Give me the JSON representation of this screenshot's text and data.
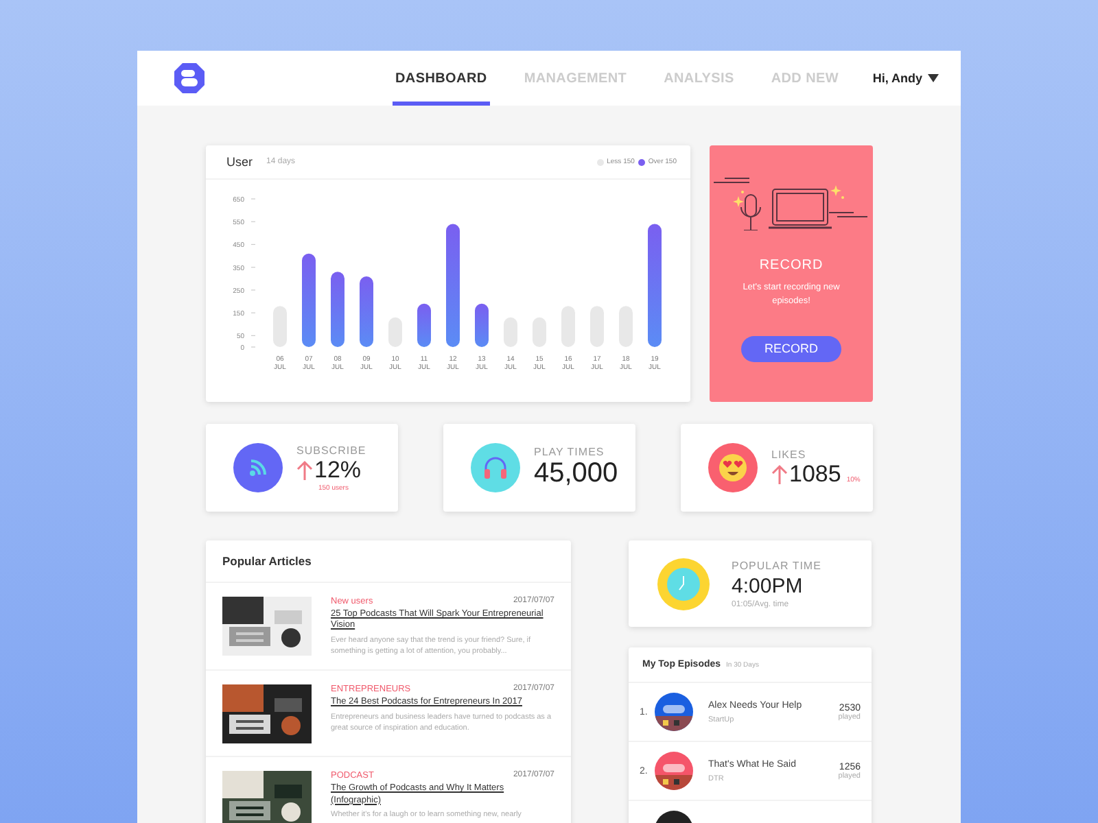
{
  "header": {
    "tabs": [
      {
        "label": "DASHBOARD",
        "selected": true
      },
      {
        "label": "MANAGEMENT",
        "selected": false
      },
      {
        "label": "ANALYSIS",
        "selected": false
      },
      {
        "label": "ADD NEW",
        "selected": false
      }
    ],
    "user": "Hi, Andy"
  },
  "user_chart": {
    "title": "User",
    "subtitle": "14 days",
    "chart_data": {
      "type": "bar",
      "categories": [
        "06 JUL",
        "07 JUL",
        "08 JUL",
        "09 JUL",
        "10 JUL",
        "11 JUL",
        "12 JUL",
        "13 JUL",
        "14 JUL",
        "15 JUL",
        "16 JUL",
        "17 JUL",
        "18 JUL",
        "19 JUL"
      ],
      "series": [
        {
          "name": "Less 150",
          "color": "#e8e8e8",
          "values": [
            180,
            null,
            null,
            null,
            130,
            null,
            null,
            null,
            130,
            130,
            180,
            180,
            180,
            null
          ]
        },
        {
          "name": "Over 150",
          "color": "#7a5ff0",
          "values": [
            null,
            410,
            330,
            310,
            null,
            190,
            540,
            190,
            null,
            null,
            null,
            null,
            null,
            540
          ]
        }
      ],
      "ylim": [
        0,
        650
      ],
      "yticks": [
        0,
        50,
        150,
        250,
        350,
        450,
        550,
        650
      ]
    }
  },
  "record": {
    "title": "RECORD",
    "text": "Let's start recording new episodes!",
    "button": "RECORD"
  },
  "stats": [
    {
      "kind": "subscribe",
      "label": "SUBSCRIBE",
      "value": "12%",
      "note": "150 users"
    },
    {
      "kind": "plays",
      "label": "PLAY TIMES",
      "value": "45,000"
    },
    {
      "kind": "likes",
      "label": "LIKES",
      "value": "1085",
      "note": "10%"
    }
  ],
  "articles": {
    "title": "Popular Articles",
    "items": [
      {
        "tag": "New users",
        "date": "2017/07/07",
        "title": "25 Top Podcasts That Will Spark Your Entrepreneurial Vision",
        "excerpt": "Ever heard anyone say that the trend is your friend? Sure, if something is getting a lot of attention, you probably..."
      },
      {
        "tag": "ENTREPRENEURS",
        "date": "2017/07/07",
        "title": "The 24 Best Podcasts for Entrepreneurs In 2017",
        "excerpt": "Entrepreneurs and business leaders have turned to podcasts as a great source of inspiration and education."
      },
      {
        "tag": "PODCAST",
        "date": "2017/07/07",
        "title": "The Growth of Podcasts and Why It Matters (Infographic)",
        "excerpt": "Whether it's for a laugh or to learn something new, nearly"
      }
    ]
  },
  "popular_time": {
    "label": "POPULAR TIME",
    "value": "4:00PM",
    "note": "01:05/Avg. time"
  },
  "episodes": {
    "title": "My Top Episodes",
    "subtitle": "In 30 Days",
    "items": [
      {
        "kind": "row",
        "rank": "1.",
        "title": "Alex Needs Your Help",
        "show": "StartUp",
        "count": "2530",
        "unit": "played",
        "color": "#1a5fe0"
      },
      {
        "kind": "row",
        "rank": "2.",
        "title": "That's What He Said",
        "show": "DTR",
        "count": "1256",
        "unit": "played",
        "color": "#f5556a"
      },
      {
        "kind": "cover-only",
        "color": "#222222"
      }
    ]
  }
}
